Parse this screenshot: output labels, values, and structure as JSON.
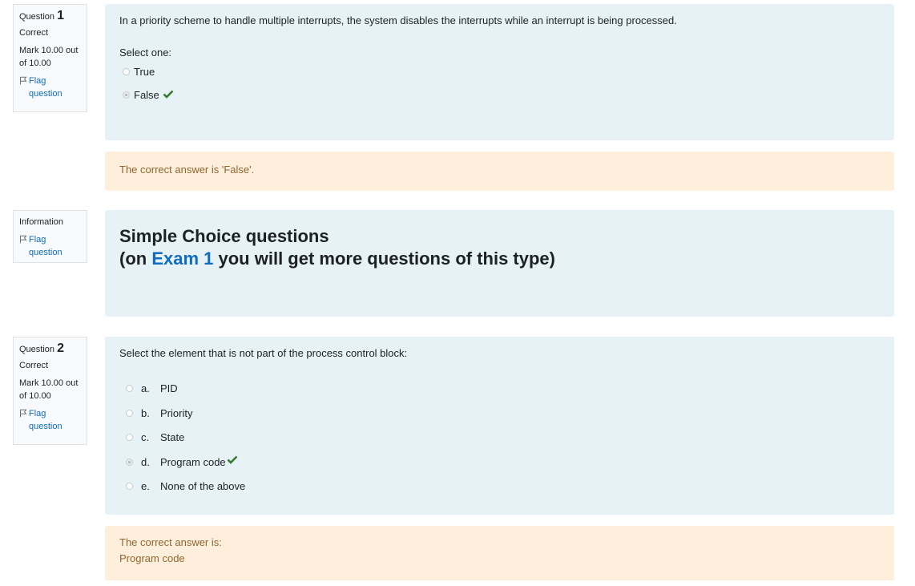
{
  "q1": {
    "label": "Question",
    "number": "1",
    "state": "Correct",
    "grade": "Mark 10.00 out of 10.00",
    "flag": "Flag question",
    "text": "In a priority scheme to handle multiple interrupts, the system disables the interrupts while an interrupt is being processed.",
    "prompt": "Select one:",
    "options": [
      "True",
      "False"
    ],
    "feedback": "The correct answer is 'False'."
  },
  "info": {
    "label": "Information",
    "flag": "Flag question",
    "heading_line1": "Simple Choice questions",
    "heading_pre": "(on ",
    "heading_exam": "Exam 1",
    "heading_post": " you will get more questions of this type)"
  },
  "q2": {
    "label": "Question",
    "number": "2",
    "state": "Correct",
    "grade": "Mark 10.00 out of 10.00",
    "flag": "Flag question",
    "text": "Select the element that is not part of the process control block:",
    "options": [
      {
        "letter": "a.",
        "text": "PID"
      },
      {
        "letter": "b.",
        "text": "Priority"
      },
      {
        "letter": "c.",
        "text": "State"
      },
      {
        "letter": "d.",
        "text": "Program code"
      },
      {
        "letter": "e.",
        "text": "None of the above"
      }
    ],
    "feedback_line1": "The correct answer is:",
    "feedback_line2": "Program code"
  },
  "colors": {
    "link": "#0f6cbf",
    "correct": "#357a32",
    "question_bg": "#e6f2f6",
    "feedback_bg": "#fdefdc"
  },
  "icons": [
    "flag-icon",
    "checkmark-icon"
  ]
}
